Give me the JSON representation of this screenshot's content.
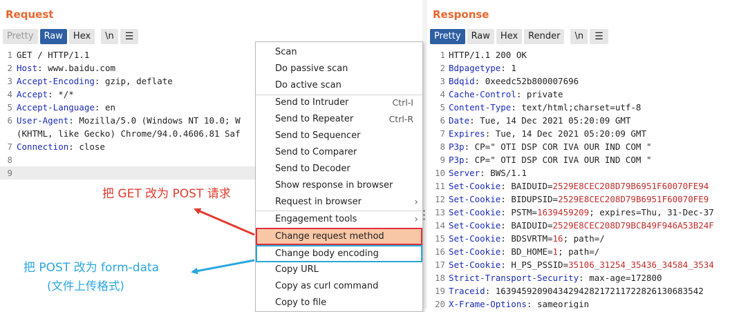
{
  "request": {
    "title": "Request",
    "tabs": [
      "Pretty",
      "Raw",
      "Hex",
      "\\n"
    ],
    "active_tab": "Raw",
    "lines": [
      {
        "n": "1",
        "key": "",
        "val": "GET / HTTP/1.1"
      },
      {
        "n": "2",
        "key": "Host",
        "val": ": www.baidu.com"
      },
      {
        "n": "3",
        "key": "Accept-Encoding",
        "val": ": gzip, deflate"
      },
      {
        "n": "4",
        "key": "Accept",
        "val": ": */*"
      },
      {
        "n": "5",
        "key": "Accept-Language",
        "val": ": en"
      },
      {
        "n": "6",
        "key": "User-Agent",
        "val": ": Mozilla/5.0 (Windows NT 10.0; W"
      },
      {
        "n": "",
        "key": "",
        "val": "(KHTML, like Gecko) Chrome/94.0.4606.81 Saf"
      },
      {
        "n": "7",
        "key": "Connection",
        "val": ": close"
      },
      {
        "n": "8",
        "key": "",
        "val": ""
      },
      {
        "n": "9",
        "key": "",
        "val": ""
      }
    ]
  },
  "response": {
    "title": "Response",
    "tabs": [
      "Pretty",
      "Raw",
      "Hex",
      "Render",
      "\\n"
    ],
    "active_tab": "Pretty",
    "lines": [
      {
        "n": "1",
        "key": "",
        "val": "HTTP/1.1 200 OK",
        "cookie": ""
      },
      {
        "n": "2",
        "key": "Bdpagetype",
        "val": ": 1",
        "cookie": ""
      },
      {
        "n": "3",
        "key": "Bdqid",
        "val": ": 0xeedc52b800007696",
        "cookie": ""
      },
      {
        "n": "4",
        "key": "Cache-Control",
        "val": ": private",
        "cookie": ""
      },
      {
        "n": "5",
        "key": "Content-Type",
        "val": ": text/html;charset=utf-8",
        "cookie": ""
      },
      {
        "n": "6",
        "key": "Date",
        "val": ": Tue, 14 Dec 2021 05:20:09 GMT",
        "cookie": ""
      },
      {
        "n": "7",
        "key": "Expires",
        "val": ": Tue, 14 Dec 2021 05:20:09 GMT",
        "cookie": ""
      },
      {
        "n": "8",
        "key": "P3p",
        "val": ": CP=\" OTI DSP COR IVA OUR IND COM \"",
        "cookie": ""
      },
      {
        "n": "9",
        "key": "P3p",
        "val": ": CP=\" OTI DSP COR IVA OUR IND COM \"",
        "cookie": ""
      },
      {
        "n": "10",
        "key": "Server",
        "val": ": BWS/1.1",
        "cookie": ""
      },
      {
        "n": "11",
        "key": "Set-Cookie",
        "val": ": BAIDUID=",
        "cookie": "2529E8CEC208D79B6951F60070FE94"
      },
      {
        "n": "12",
        "key": "Set-Cookie",
        "val": ": BIDUPSID=",
        "cookie": "2529E8CEC208D79B6951F60070FE9"
      },
      {
        "n": "13",
        "key": "Set-Cookie",
        "val": ": PSTM=",
        "cookie": "1639459209",
        "tail": "; expires=Thu, 31-Dec-37"
      },
      {
        "n": "14",
        "key": "Set-Cookie",
        "val": ": BAIDUID=",
        "cookie": "2529E8CEC208D79BCB49F946A53B24F"
      },
      {
        "n": "15",
        "key": "Set-Cookie",
        "val": ": BDSVRTM=",
        "cookie": "16",
        "tail": "; path=/"
      },
      {
        "n": "16",
        "key": "Set-Cookie",
        "val": ": BD_HOME=",
        "cookie": "1",
        "tail": "; path=/"
      },
      {
        "n": "17",
        "key": "Set-Cookie",
        "val": ": H_PS_PSSID=",
        "cookie": "35106_31254_35436_34584_3534"
      },
      {
        "n": "18",
        "key": "Strict-Transport-Security",
        "val": ": max-age=172800",
        "cookie": ""
      },
      {
        "n": "19",
        "key": "Traceid",
        "val": ": 1639459209043429428217211722826130683542",
        "cookie": ""
      },
      {
        "n": "20",
        "key": "X-Frame-Options",
        "val": ": sameorigin",
        "cookie": ""
      }
    ]
  },
  "context_menu": {
    "items": [
      {
        "label": "Scan",
        "shortcut": "",
        "submenu": false
      },
      {
        "label": "Do passive scan",
        "shortcut": "",
        "submenu": false
      },
      {
        "label": "Do active scan",
        "shortcut": "",
        "submenu": false
      },
      {
        "label": "Send to Intruder",
        "shortcut": "Ctrl-I",
        "submenu": false
      },
      {
        "label": "Send to Repeater",
        "shortcut": "Ctrl-R",
        "submenu": false
      },
      {
        "label": "Send to Sequencer",
        "shortcut": "",
        "submenu": false
      },
      {
        "label": "Send to Comparer",
        "shortcut": "",
        "submenu": false
      },
      {
        "label": "Send to Decoder",
        "shortcut": "",
        "submenu": false
      },
      {
        "label": "Show response in browser",
        "shortcut": "",
        "submenu": false
      },
      {
        "label": "Request in browser",
        "shortcut": "",
        "submenu": true
      },
      {
        "label": "Engagement tools",
        "shortcut": "",
        "submenu": true
      },
      {
        "label": "Change request method",
        "shortcut": "",
        "submenu": false
      },
      {
        "label": "Change body encoding",
        "shortcut": "",
        "submenu": false
      },
      {
        "label": "Copy URL",
        "shortcut": "",
        "submenu": false
      },
      {
        "label": "Copy as curl command",
        "shortcut": "",
        "submenu": false
      },
      {
        "label": "Copy to file",
        "shortcut": "",
        "submenu": false
      }
    ]
  },
  "annotations": {
    "get_to_post": "把 GET 改为 POST 请求",
    "post_to_form": "把 POST 改为 form-data",
    "post_to_form_note": "(文件上传格式)"
  },
  "colors": {
    "accent": "#e8662e",
    "header_key": "#1a2bb8",
    "cookie_value": "#c22c2c",
    "active_tab": "#2e5fa3",
    "annotation_red": "#e23b2f",
    "annotation_blue": "#2aa7e0"
  }
}
